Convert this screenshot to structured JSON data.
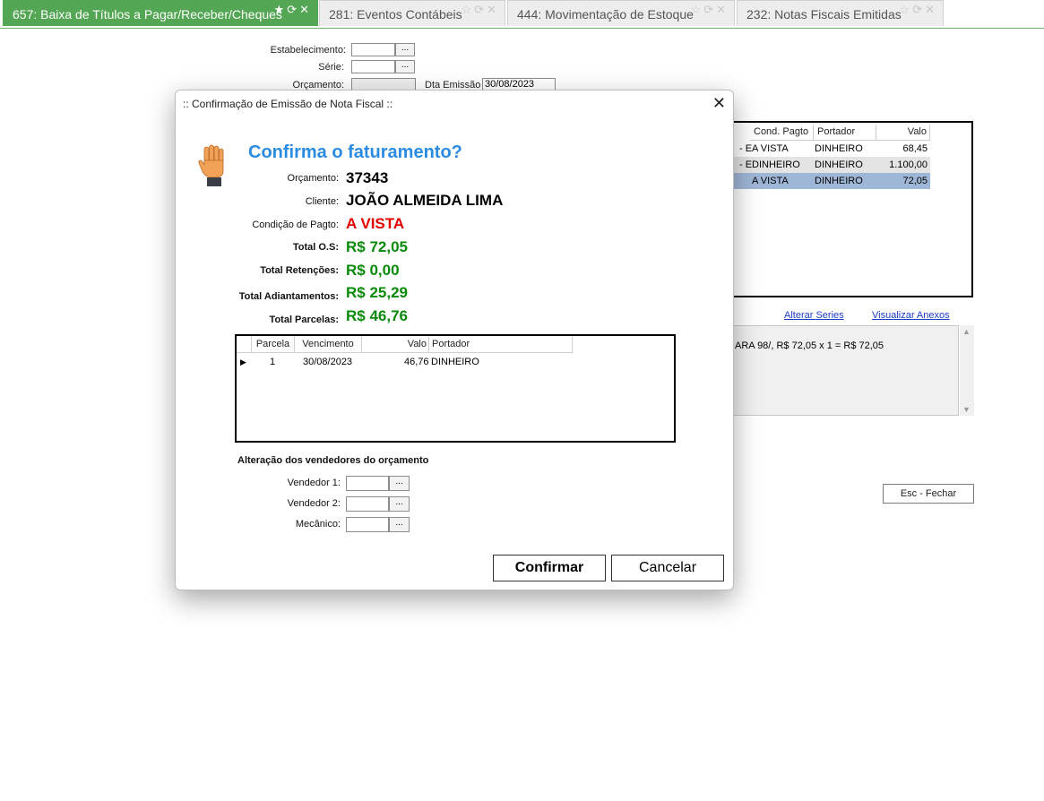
{
  "tabs": [
    {
      "label": "657: Baixa de Títulos a Pagar/Receber/Cheques"
    },
    {
      "label": "281: Eventos Contábeis"
    },
    {
      "label": "444: Movimentação de Estoque"
    },
    {
      "label": "232: Notas Fiscais Emitidas"
    }
  ],
  "form": {
    "estabelecimento_label": "Estabelecimento:",
    "serie_label": "Série:",
    "orcamento_label": "Orçamento:",
    "dta_emissao_label": "Dta Emissão",
    "dta_emissao_value": "30/08/2023",
    "dots": "..."
  },
  "bg_grid": {
    "headers": [
      "Cond. Pagto",
      "Portador",
      "Valo"
    ],
    "rows": [
      {
        "prefix": "- E",
        "cond": "A VISTA",
        "portador": "DINHEIRO",
        "valor": "68,45"
      },
      {
        "prefix": "- E",
        "cond": "DINHEIRO",
        "portador": "DINHEIRO",
        "valor": "1.100,00"
      },
      {
        "prefix": "",
        "cond": "A VISTA",
        "portador": "DINHEIRO",
        "valor": "72,05"
      }
    ]
  },
  "links": {
    "alterar_series": "Alterar Series",
    "visualizar_anexos": "Visualizar Anexos"
  },
  "observacao": "ARA 98/, R$ 72,05 x 1 = R$ 72,05",
  "esc_button": "Esc - Fechar",
  "dialog": {
    "title": ":: Confirmação de Emissão de Nota Fiscal ::",
    "close": "✕",
    "question": "Confirma o faturamento?",
    "fields": {
      "orcamento_label": "Orçamento:",
      "orcamento_value": "37343",
      "cliente_label": "Cliente:",
      "cliente_value": "JOÃO ALMEIDA LIMA",
      "condicao_label": "Condição de Pagto:",
      "condicao_value": "A  VISTA",
      "total_os_label": "Total O.S:",
      "total_os_value": "R$ 72,05",
      "total_retencoes_label": "Total Retenções:",
      "total_retencoes_value": "R$ 0,00",
      "total_adiantamentos_label": "Total Adiantamentos:",
      "total_adiantamentos_value": "R$ 25,29",
      "total_parcelas_label": "Total Parcelas:",
      "total_parcelas_value": "R$ 46,76"
    },
    "parcelas": {
      "headers": [
        "Parcela",
        "Vencimento",
        "Valo",
        "Portador"
      ],
      "rows": [
        {
          "parcela": "1",
          "vencimento": "30/08/2023",
          "valor": "46,76",
          "portador": "DINHEIRO"
        }
      ]
    },
    "vendedores": {
      "section_label": "Alteração dos vendedores do orçamento",
      "vendedor1_label": "Vendedor 1:",
      "vendedor2_label": "Vendedor 2:",
      "mecanico_label": "Mecânico:",
      "dots": "..."
    },
    "buttons": {
      "confirmar": "Confirmar",
      "cancelar": "Cancelar"
    }
  }
}
